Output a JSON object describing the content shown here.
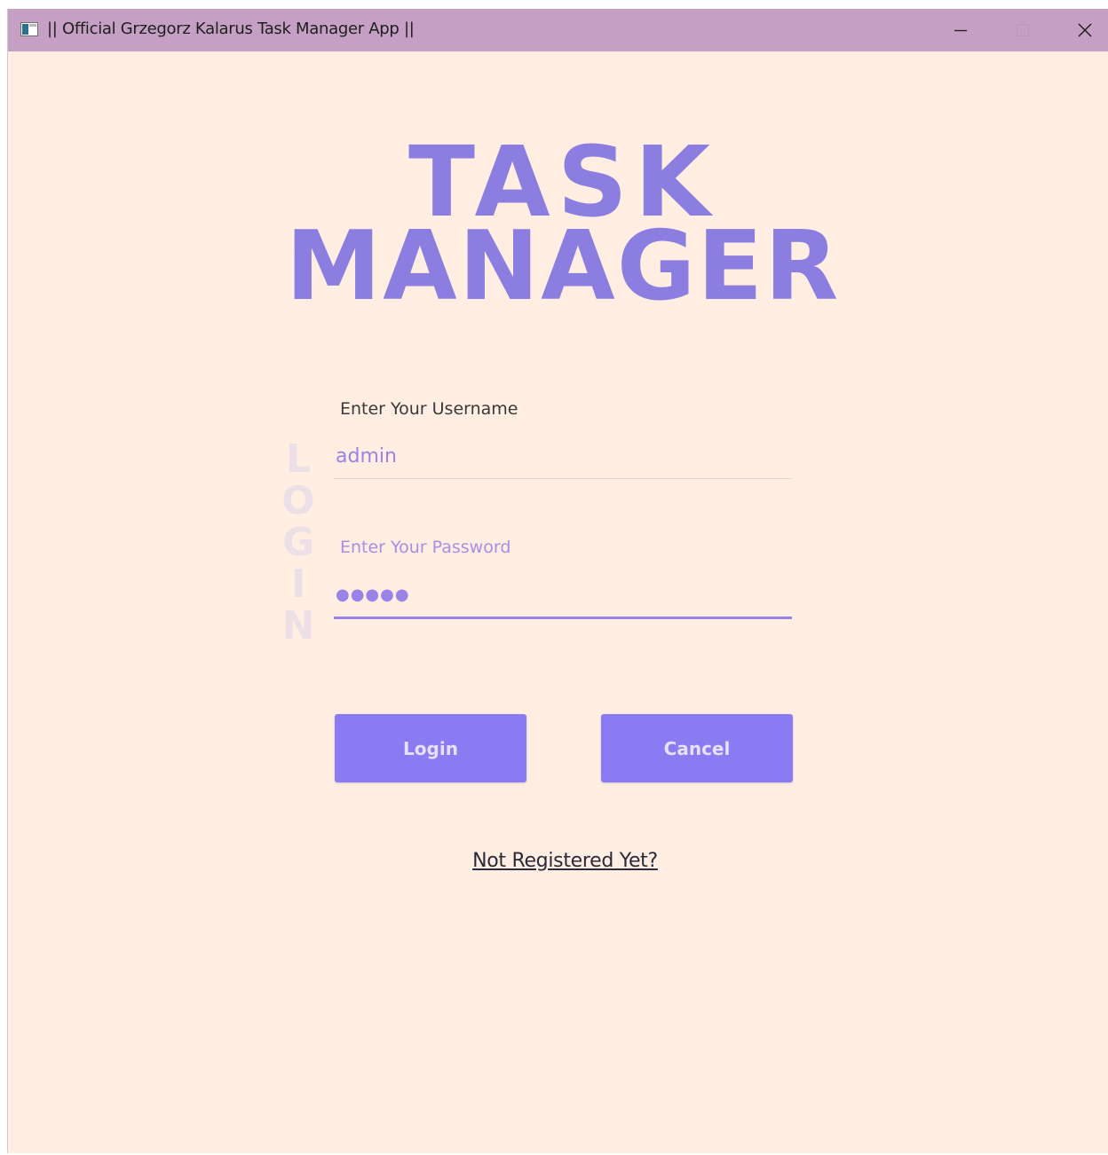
{
  "window": {
    "title": "|| Official Grzegorz Kalarus Task Manager App ||",
    "controls": {
      "minimize_icon": "minimize-icon",
      "maximize_icon": "maximize-icon",
      "close_icon": "close-icon"
    }
  },
  "logo": {
    "line1": "TASK",
    "line2": "MANAGER"
  },
  "side_word": [
    "L",
    "O",
    "G",
    "I",
    "N"
  ],
  "form": {
    "username": {
      "label": "Enter Your Username",
      "value": "admin"
    },
    "password": {
      "label": "Enter Your Password",
      "value": "●●●●●"
    },
    "login_label": "Login",
    "cancel_label": "Cancel",
    "register_link": "Not Registered Yet?"
  },
  "colors": {
    "titlebar": "#c5a0c4",
    "background": "#ffeee1",
    "accent": "#8c7ee0",
    "button": "#8b7bf2",
    "button_text": "#e8e0ff",
    "watermark": "#ece0e6"
  }
}
